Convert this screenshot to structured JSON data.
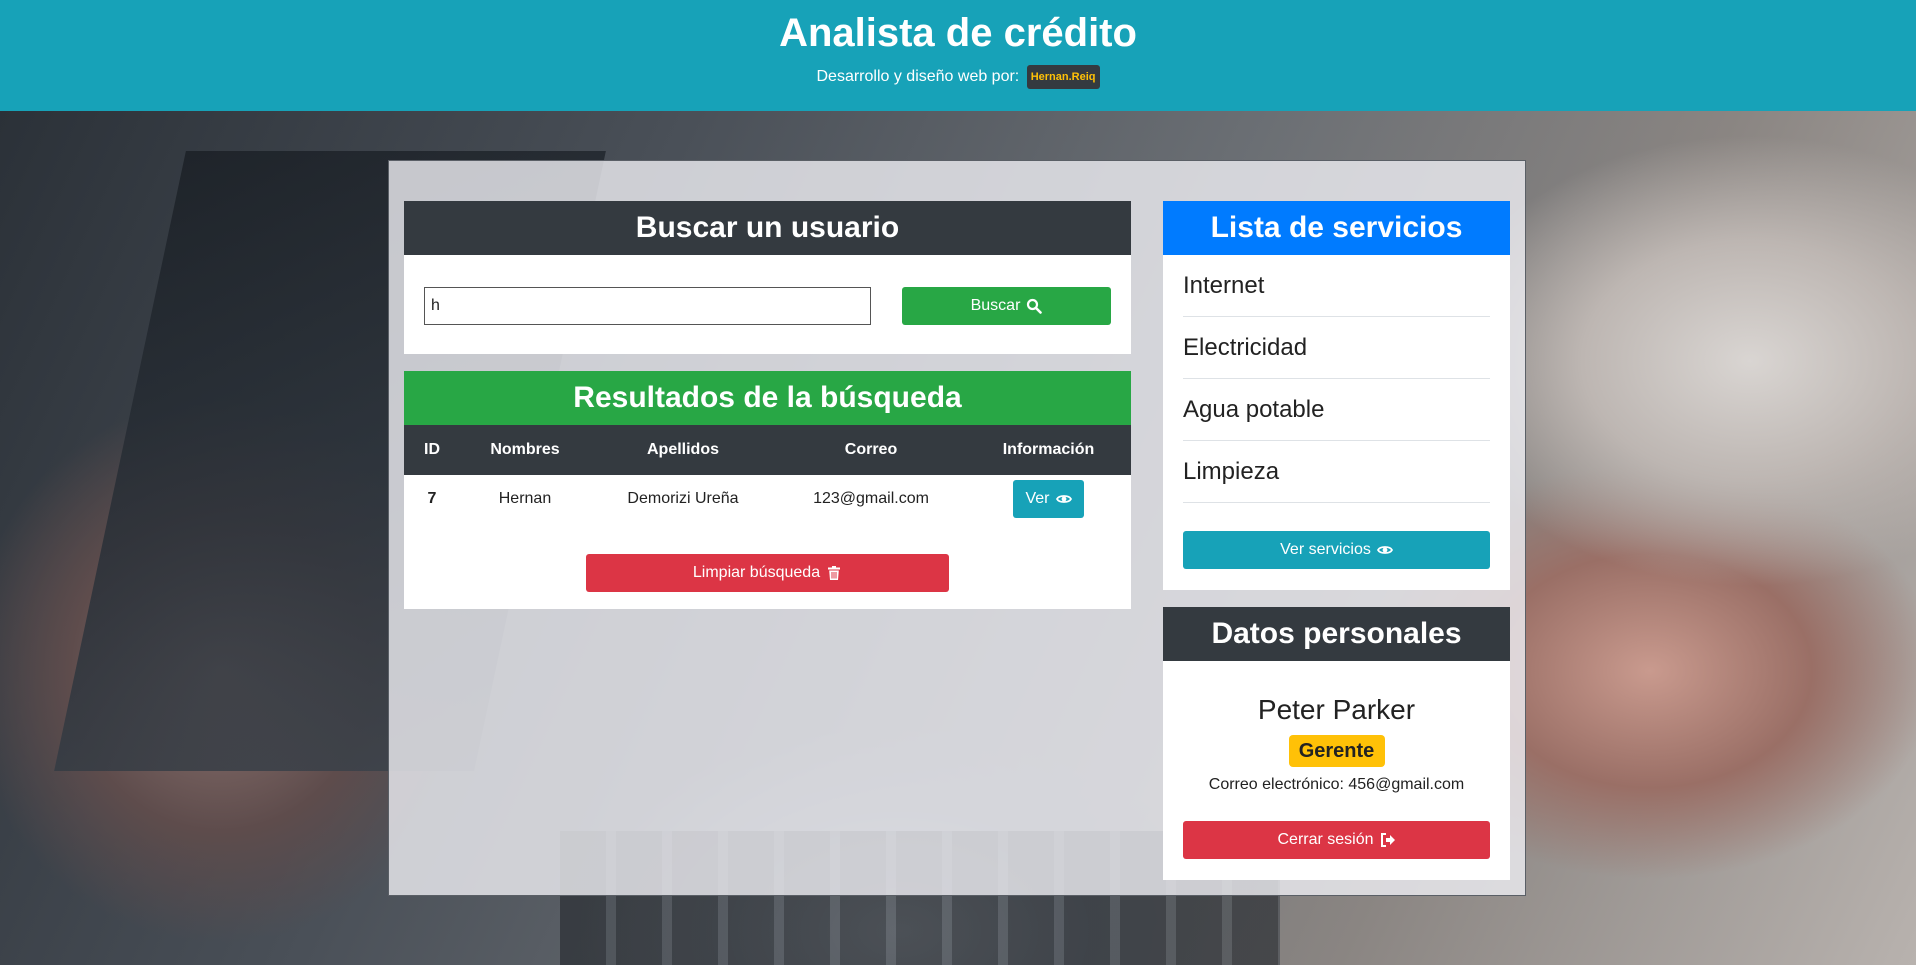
{
  "header": {
    "title": "Analista de crédito",
    "credit_text": "Desarrollo y diseño web por:",
    "credit_badge": "Hernan.Reiq"
  },
  "search": {
    "title": "Buscar un usuario",
    "input_value": "h",
    "button_label": "Buscar"
  },
  "results": {
    "title": "Resultados de la búsqueda",
    "columns": [
      "ID",
      "Nombres",
      "Apellidos",
      "Correo",
      "Información"
    ],
    "rows": [
      {
        "id": "7",
        "nombres": "Hernan",
        "apellidos": "Demorizi Ureña",
        "correo": "123@gmail.com",
        "action_label": "Ver"
      }
    ],
    "clear_label": "Limpiar búsqueda"
  },
  "services": {
    "title": "Lista de servicios",
    "items": [
      "Internet",
      "Electricidad",
      "Agua potable",
      "Limpieza"
    ],
    "button_label": "Ver servicios"
  },
  "personal": {
    "title": "Datos personales",
    "name": "Peter Parker",
    "role": "Gerente",
    "email_text": "Correo electrónico: 456@gmail.com",
    "logout_label": "Cerrar sesión"
  },
  "icons": {
    "search": "search-icon",
    "eye": "eye-icon",
    "trash": "trash-icon",
    "logout": "sign-out-icon"
  },
  "colors": {
    "header": "#17a2b8",
    "dark": "#343a40",
    "success": "#28a745",
    "primary": "#007bff",
    "danger": "#dc3545",
    "info": "#17a2b8",
    "warning": "#ffc107"
  }
}
